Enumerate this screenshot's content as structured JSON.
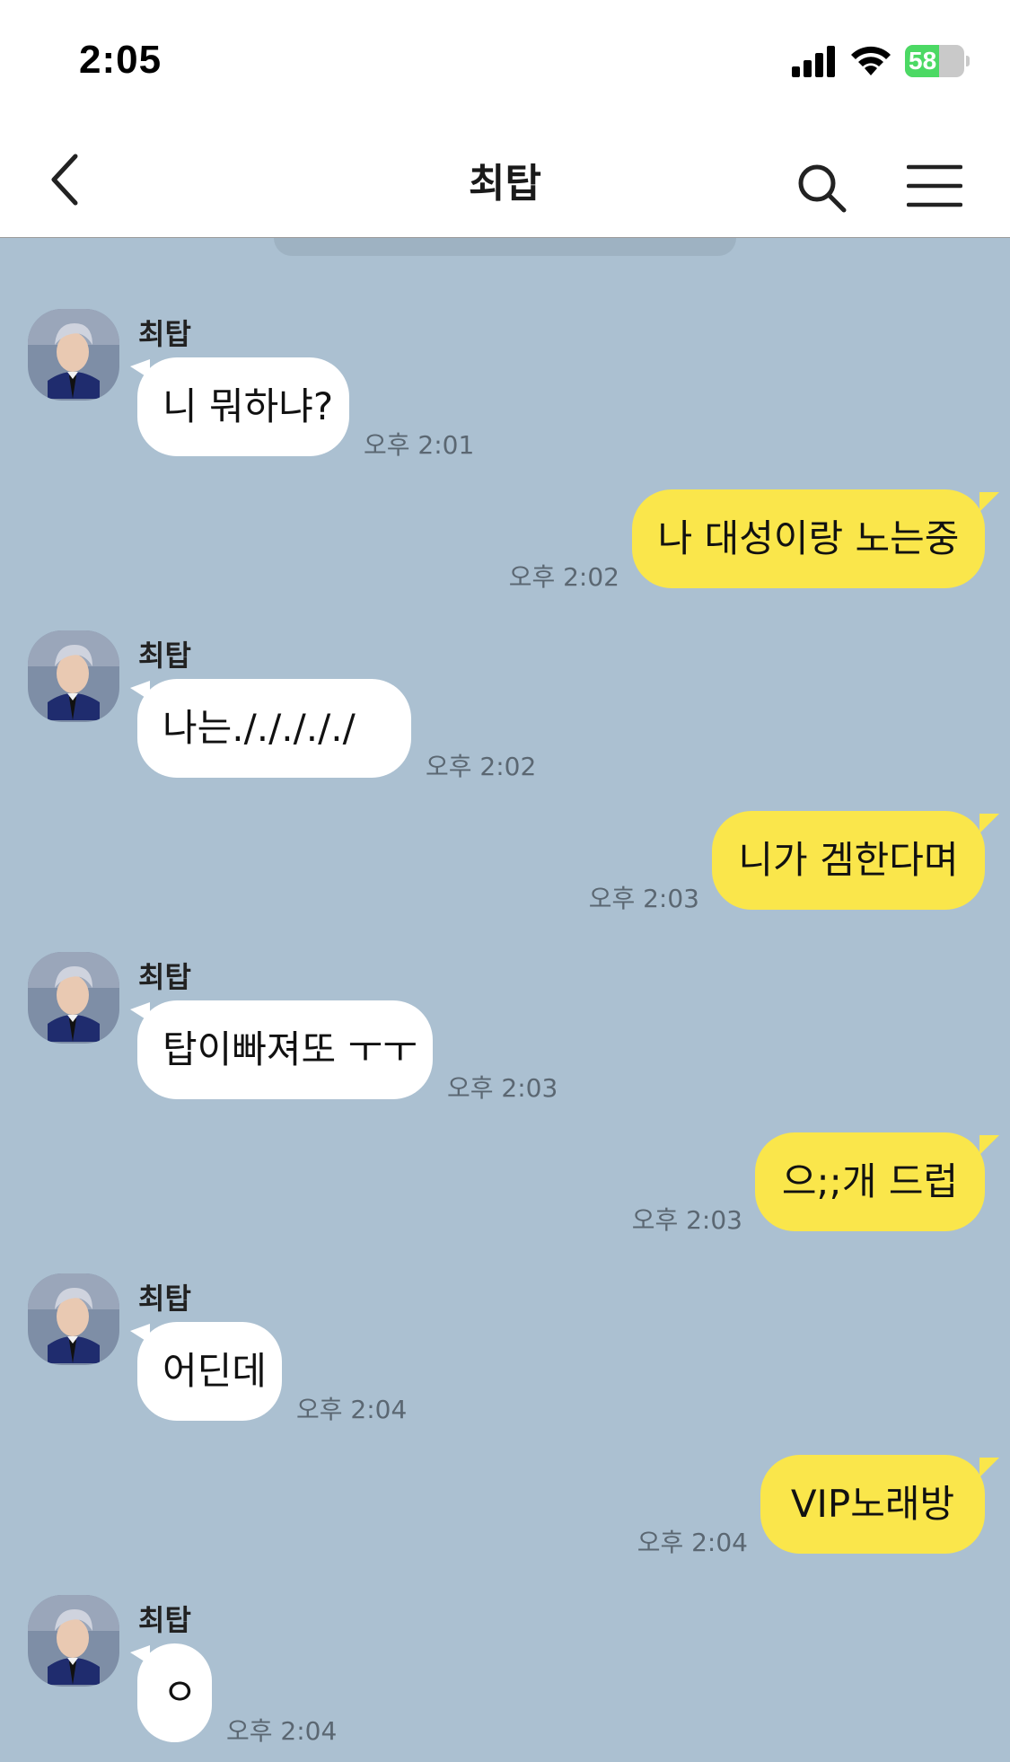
{
  "status_bar": {
    "time": "2:05",
    "battery_percent": "58",
    "battery_level": 0.58
  },
  "nav": {
    "title": "최탑",
    "icons": [
      "chevron-left-icon",
      "search-icon",
      "menu-icon"
    ]
  },
  "colors": {
    "chat_background": "#abc0d1",
    "outgoing_bubble": "#fae64b",
    "incoming_bubble": "#ffffff"
  },
  "messages": [
    {
      "direction": "in",
      "sender": "최탑",
      "text": "니 뭐하냐?",
      "time": "오후 2:01"
    },
    {
      "direction": "out",
      "text": "나 대성이랑 노는중",
      "time": "오후 2:02"
    },
    {
      "direction": "in",
      "sender": "최탑",
      "text": "나는./././././",
      "time": "오후 2:02"
    },
    {
      "direction": "out",
      "text": "니가 겜한다며",
      "time": "오후 2:03"
    },
    {
      "direction": "in",
      "sender": "최탑",
      "text": "탑이빠져또 ㅜㅜ",
      "time": "오후 2:03"
    },
    {
      "direction": "out",
      "text": "으;;개 드럽",
      "time": "오후 2:03"
    },
    {
      "direction": "in",
      "sender": "최탑",
      "text": "어딘데",
      "time": "오후 2:04"
    },
    {
      "direction": "out",
      "text": "VIP노래방",
      "time": "오후 2:04"
    },
    {
      "direction": "in",
      "sender": "최탑",
      "text": "ㅇ",
      "time": "오후 2:04"
    }
  ]
}
